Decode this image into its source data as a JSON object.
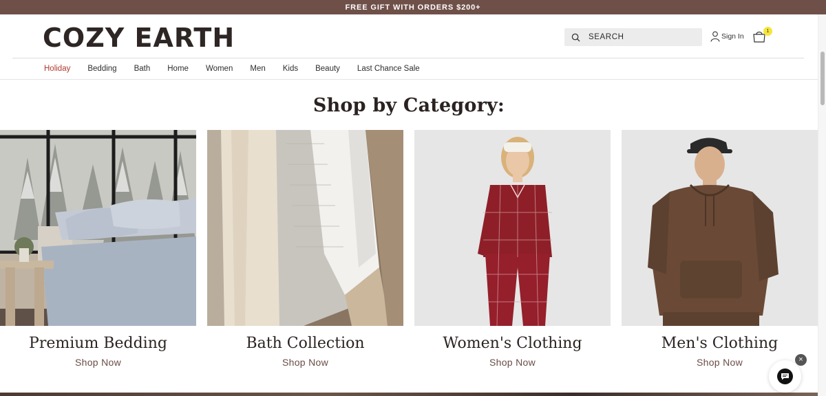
{
  "promo": {
    "text": "FREE GIFT WITH ORDERS $200+"
  },
  "header": {
    "logo": "COZY EARTH",
    "search_placeholder": "SEARCH",
    "sign_in": "Sign In",
    "cart_count": "1"
  },
  "nav": {
    "items": [
      {
        "label": "Holiday",
        "active": true
      },
      {
        "label": "Bedding"
      },
      {
        "label": "Bath"
      },
      {
        "label": "Home"
      },
      {
        "label": "Women"
      },
      {
        "label": "Men"
      },
      {
        "label": "Kids"
      },
      {
        "label": "Beauty"
      },
      {
        "label": "Last Chance Sale"
      }
    ]
  },
  "section": {
    "title": "Shop by Category:"
  },
  "categories": [
    {
      "name": "Premium Bedding",
      "cta": "Shop Now"
    },
    {
      "name": "Bath Collection",
      "cta": "Shop Now"
    },
    {
      "name": "Women's Clothing",
      "cta": "Shop Now"
    },
    {
      "name": "Men's Clothing",
      "cta": "Shop Now"
    }
  ],
  "colors": {
    "promo_bg": "#6f5049",
    "nav_active": "#b03a2e",
    "cart_badge": "#f5e63a",
    "shop_link": "#6a4c46"
  },
  "icons": {
    "search": "search-icon",
    "account": "user-icon",
    "cart": "shopping-bag-icon",
    "chat": "chat-bubble-icon",
    "close": "close-icon"
  }
}
